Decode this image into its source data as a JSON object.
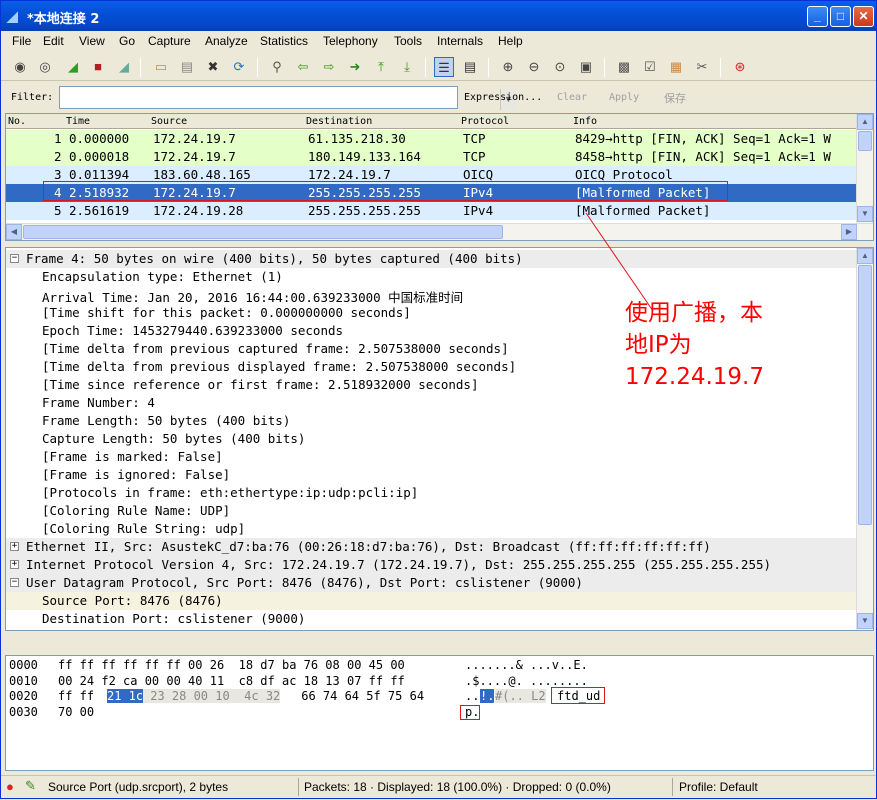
{
  "window": {
    "title": "*本地连接 2",
    "min": "_",
    "max": "□",
    "close": "✕"
  },
  "menu": [
    "File",
    "Edit",
    "View",
    "Go",
    "Capture",
    "Analyze",
    "Statistics",
    "Telephony",
    "Tools",
    "Internals",
    "Help"
  ],
  "filter": {
    "label": "Filter:",
    "value": "",
    "expression": "Expression...",
    "clear": "Clear",
    "apply": "Apply",
    "save": "保存"
  },
  "packet_list": {
    "headers": [
      "No.",
      "Time",
      "Source",
      "Destination",
      "Protocol",
      "Info"
    ],
    "rows": [
      {
        "no": "1",
        "time": "0.000000",
        "src": "172.24.19.7",
        "dst": "61.135.218.30",
        "proto": "TCP",
        "info": "8429→http [FIN, ACK] Seq=1 Ack=1 W",
        "bg": "#e4ffc7"
      },
      {
        "no": "2",
        "time": "0.000018",
        "src": "172.24.19.7",
        "dst": "180.149.133.164",
        "proto": "TCP",
        "info": "8458→http [FIN, ACK] Seq=1 Ack=1 W",
        "bg": "#e4ffc7"
      },
      {
        "no": "3",
        "time": "0.011394",
        "src": "183.60.48.165",
        "dst": "172.24.19.7",
        "proto": "OICQ",
        "info": "OICQ Protocol",
        "bg": "#daeeff"
      },
      {
        "no": "4",
        "time": "2.518932",
        "src": "172.24.19.7",
        "dst": "255.255.255.255",
        "proto": "IPv4",
        "info": "[Malformed Packet]",
        "bg": "#316ac5",
        "selected": true
      },
      {
        "no": "5",
        "time": "2.561619",
        "src": "172.24.19.28",
        "dst": "255.255.255.255",
        "proto": "IPv4",
        "info": "[Malformed Packet]",
        "bg": "#daeeff"
      }
    ]
  },
  "details": [
    {
      "text": "Frame 4: 50 bytes on wire (400 bits), 50 bytes captured (400 bits)",
      "level": 0,
      "exp": "−",
      "bg": "#ececec"
    },
    {
      "text": "Encapsulation type: Ethernet (1)",
      "level": 1
    },
    {
      "text": "Arrival Time: Jan 20, 2016 16:44:00.639233000 中国标准时间",
      "level": 1
    },
    {
      "text": "[Time shift for this packet: 0.000000000 seconds]",
      "level": 1
    },
    {
      "text": "Epoch Time: 1453279440.639233000 seconds",
      "level": 1
    },
    {
      "text": "[Time delta from previous captured frame: 2.507538000 seconds]",
      "level": 1
    },
    {
      "text": "[Time delta from previous displayed frame: 2.507538000 seconds]",
      "level": 1
    },
    {
      "text": "[Time since reference or first frame: 2.518932000 seconds]",
      "level": 1
    },
    {
      "text": "Frame Number: 4",
      "level": 1
    },
    {
      "text": "Frame Length: 50 bytes (400 bits)",
      "level": 1
    },
    {
      "text": "Capture Length: 50 bytes (400 bits)",
      "level": 1
    },
    {
      "text": "[Frame is marked: False]",
      "level": 1
    },
    {
      "text": "[Frame is ignored: False]",
      "level": 1
    },
    {
      "text": "[Protocols in frame: eth:ethertype:ip:udp:pcli:ip]",
      "level": 1
    },
    {
      "text": "[Coloring Rule Name: UDP]",
      "level": 1
    },
    {
      "text": "[Coloring Rule String: udp]",
      "level": 1
    },
    {
      "text": "Ethernet II, Src: AsustekC_d7:ba:76 (00:26:18:d7:ba:76), Dst: Broadcast (ff:ff:ff:ff:ff:ff)",
      "level": 0,
      "exp": "+",
      "bg": "#ececec"
    },
    {
      "text": "Internet Protocol Version 4, Src: 172.24.19.7 (172.24.19.7), Dst: 255.255.255.255 (255.255.255.255)",
      "level": 0,
      "exp": "+",
      "bg": "#ececec"
    },
    {
      "text": "User Datagram Protocol, Src Port: 8476 (8476), Dst Port: cslistener (9000)",
      "level": 0,
      "exp": "−",
      "bg": "#ececec"
    },
    {
      "text": "Source Port: 8476 (8476)",
      "level": 1,
      "bg": "#f5f3df"
    },
    {
      "text": "Destination Port: cslistener (9000)",
      "level": 1
    }
  ],
  "hex": [
    {
      "offset": "0000",
      "bytes": "ff ff ff ff ff ff 00 26  18 d7 ba 76 08 00 45 00",
      "ascii": ".......& ...v..E."
    },
    {
      "offset": "0010",
      "bytes": "00 24 f2 ca 00 00 40 11  c8 df ac 18 13 07 ff ff",
      "ascii": ".$....@. ........"
    },
    {
      "offset": "0020",
      "bytes_a": "ff ff ",
      "bytes_sel": "21 1c",
      "bytes_gray": " 23 28 00 10  4c 32",
      "bytes_b": " 66 74 64 5f 75 64",
      "ascii_a": "..",
      "ascii_sel": "!.",
      "ascii_gray": "#(.. L2",
      "ascii_b": "ftd_ud"
    },
    {
      "offset": "0030",
      "bytes": "70 00",
      "ascii": "p."
    }
  ],
  "annotation": {
    "line1": "使用广播，本",
    "line2": "地IP为",
    "line3": "172.24.19.7"
  },
  "status": {
    "field": "Source Port (udp.srcport), 2 bytes",
    "packets": "Packets: 18 · Displayed: 18 (100.0%) · Dropped: 0 (0.0%)",
    "profile": "Profile: Default"
  }
}
